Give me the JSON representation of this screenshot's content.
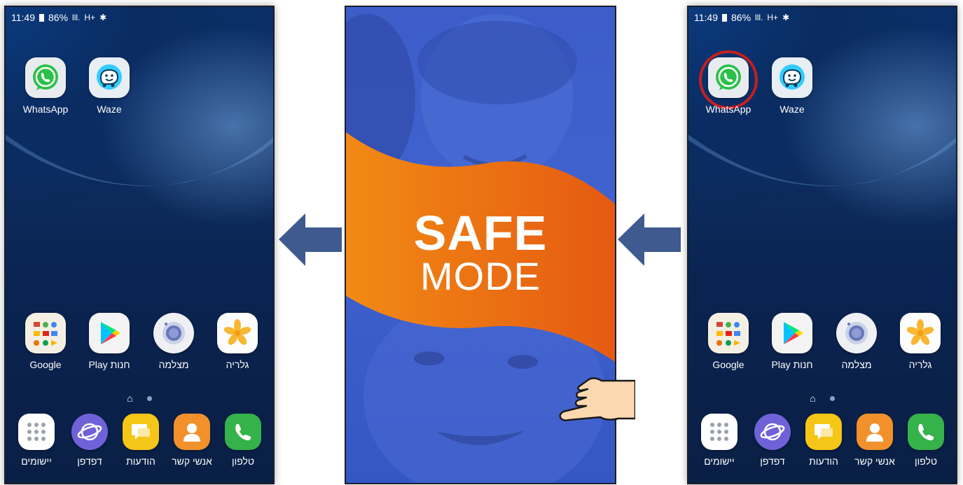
{
  "status_bar": {
    "time": "11:49",
    "battery": "86%",
    "signal": "lll.",
    "network": "H+",
    "bluetooth": "✱"
  },
  "home_top_apps": [
    {
      "label": "WhatsApp",
      "icon": "whatsapp-icon"
    },
    {
      "label": "Waze",
      "icon": "waze-icon"
    }
  ],
  "home_mid_apps": [
    {
      "label": "Google",
      "icon": "google-folder-icon"
    },
    {
      "label": "Play חנות",
      "icon": "play-store-icon"
    },
    {
      "label": "מצלמה",
      "icon": "camera-icon"
    },
    {
      "label": "גלריה",
      "icon": "gallery-icon"
    }
  ],
  "dock_apps": [
    {
      "label": "יישומים",
      "icon": "apps-grid-icon"
    },
    {
      "label": "דפדפן",
      "icon": "browser-icon"
    },
    {
      "label": "הודעות",
      "icon": "messages-icon"
    },
    {
      "label": "אנשי קשר",
      "icon": "contacts-icon"
    },
    {
      "label": "טלפון",
      "icon": "phone-icon"
    }
  ],
  "safe_mode": {
    "line1": "SAFE",
    "line2": "MODE"
  },
  "colors": {
    "wallpaper": "#0a2e66",
    "safe_band": "#f07c16",
    "safe_overlay": "#3f62cf",
    "arrow": "#3e5a8f",
    "highlight": "#c61f1f"
  }
}
